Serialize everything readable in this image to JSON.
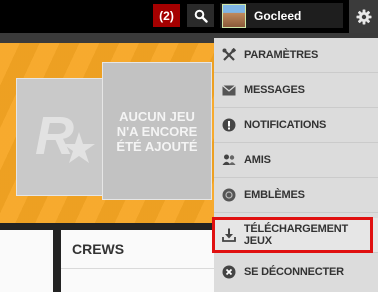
{
  "header": {
    "notification_count": "(2)",
    "username": "Gocleed"
  },
  "banner": {
    "empty_message": "AUCUN JEU N'A ENCORE ÉTÉ AJOUTÉ"
  },
  "crews": {
    "title": "CREWS"
  },
  "menu": {
    "items": [
      {
        "label": "PARAMÈTRES",
        "icon": "tools-icon"
      },
      {
        "label": "MESSAGES",
        "icon": "envelope-icon"
      },
      {
        "label": "NOTIFICATIONS",
        "icon": "alert-icon"
      },
      {
        "label": "AMIS",
        "icon": "friends-icon"
      },
      {
        "label": "EMBLÈMES",
        "icon": "emblem-icon"
      },
      {
        "label": "TÉLÉCHARGEMENT JEUX",
        "icon": "download-icon"
      },
      {
        "label": "SE DÉCONNECTER",
        "icon": "logout-icon"
      }
    ],
    "highlighted_item": "TÉLÉCHARGEMENT JEUX",
    "highlight_color": "#e01010"
  },
  "colors": {
    "banner_orange": "#f7a623",
    "badge_red": "#a50000"
  }
}
